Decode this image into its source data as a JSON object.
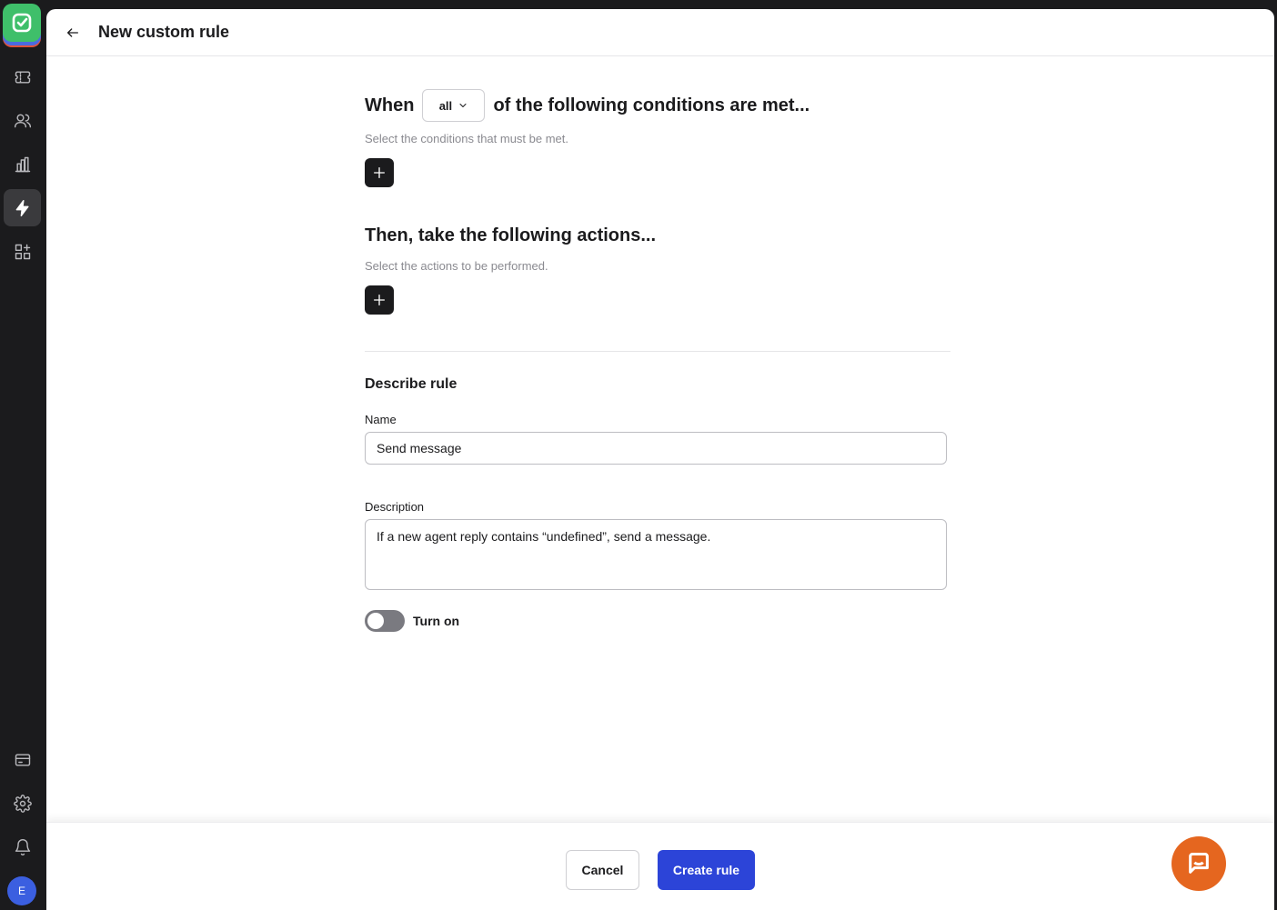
{
  "header": {
    "title": "New custom rule"
  },
  "conditions": {
    "when_label": "When",
    "match_value": "all",
    "suffix": "of the following conditions are met...",
    "hint": "Select the conditions that must be met."
  },
  "actions": {
    "title": "Then, take the following actions...",
    "hint": "Select the actions to be performed."
  },
  "describe": {
    "title": "Describe rule",
    "name_label": "Name",
    "name_value": "Send message",
    "description_label": "Description",
    "description_value": "If a new agent reply contains “undefined”, send a message."
  },
  "toggle": {
    "label": "Turn on",
    "on": false
  },
  "footer": {
    "cancel_label": "Cancel",
    "create_label": "Create rule"
  },
  "user": {
    "initial": "E"
  },
  "colors": {
    "primary": "#2c44d8",
    "sidebar": "#1b1b1d",
    "chat": "#e5661f",
    "logo": "#3fbf6a"
  },
  "icons": [
    "app-logo-icon",
    "tickets-icon",
    "customers-icon",
    "reports-icon",
    "automation-icon",
    "apps-icon",
    "billing-icon",
    "settings-icon",
    "bell-icon",
    "back-arrow-icon",
    "chevron-down-icon",
    "plus-icon",
    "chat-icon"
  ]
}
